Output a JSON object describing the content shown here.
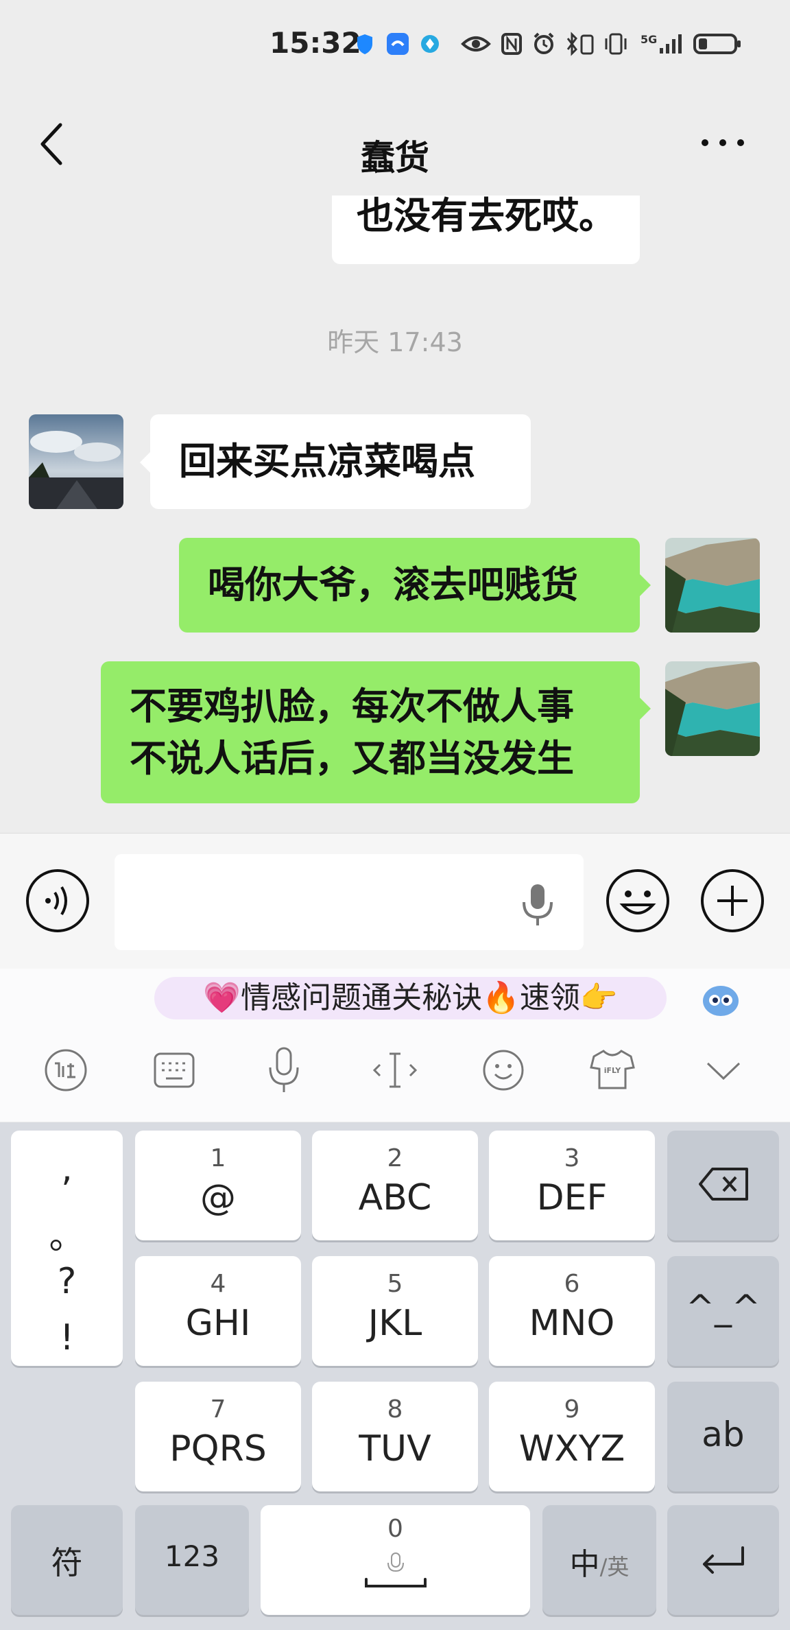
{
  "status_bar": {
    "time": "15:32",
    "signal": "5G"
  },
  "header": {
    "title": "蠢货"
  },
  "messages": [
    {
      "side": "right",
      "color": "white",
      "lines": [
        "也没有去死哎。"
      ]
    },
    {
      "type": "timestamp",
      "text": "昨天 17:43"
    },
    {
      "side": "left",
      "color": "white",
      "lines": [
        "回来买点凉菜喝点"
      ]
    },
    {
      "side": "right",
      "color": "green",
      "lines": [
        "喝你大爷，滚去吧贱货"
      ]
    },
    {
      "side": "right",
      "color": "green",
      "lines": [
        "不要鸡扒脸，每次不做人事",
        "不说人话后，又都当没发生"
      ]
    }
  ],
  "input": {
    "value": "",
    "placeholder": ""
  },
  "banner": {
    "text": "💗情感问题通关秘诀🔥速领👉"
  },
  "keyboard": {
    "left_column": [
      ",",
      "。",
      "?",
      "!"
    ],
    "keys": [
      {
        "num": "1",
        "label": "@"
      },
      {
        "num": "2",
        "label": "ABC"
      },
      {
        "num": "3",
        "label": "DEF"
      },
      {
        "num": "4",
        "label": "GHI"
      },
      {
        "num": "5",
        "label": "JKL"
      },
      {
        "num": "6",
        "label": "MNO"
      },
      {
        "num": "7",
        "label": "PQRS"
      },
      {
        "num": "8",
        "label": "TUV"
      },
      {
        "num": "9",
        "label": "WXYZ"
      }
    ],
    "face_key": "^_^",
    "ab_key": "ab",
    "symbol_key": "符",
    "num_key": "123",
    "space_num": "0",
    "lang_main": "中",
    "lang_alt": "/英"
  },
  "colors": {
    "green_bubble": "#95ec69",
    "background": "#ededed",
    "keyboard": "#d8dbe1"
  }
}
